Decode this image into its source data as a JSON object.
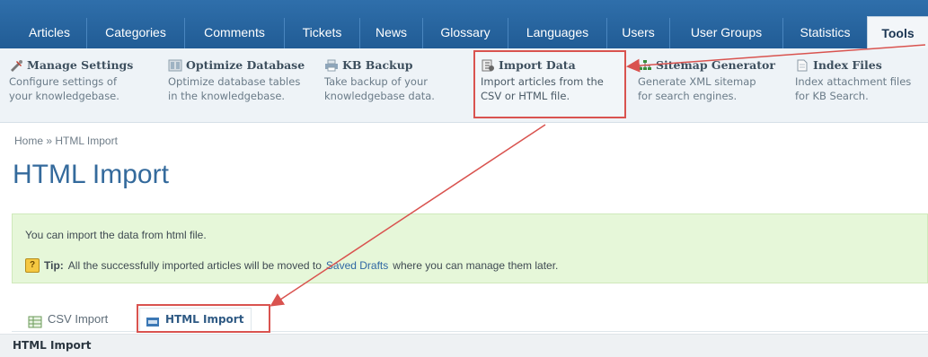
{
  "nav": {
    "tabs": [
      {
        "label": "Articles"
      },
      {
        "label": "Categories"
      },
      {
        "label": "Comments"
      },
      {
        "label": "Tickets"
      },
      {
        "label": "News"
      },
      {
        "label": "Glossary"
      },
      {
        "label": "Languages"
      },
      {
        "label": "Users"
      },
      {
        "label": "User Groups"
      },
      {
        "label": "Statistics"
      },
      {
        "label": "Tools"
      }
    ],
    "active": "Tools"
  },
  "tools": [
    {
      "title": "Manage Settings",
      "line1": "Configure settings of",
      "line2": "your knowledgebase.",
      "icon": "tools-icon"
    },
    {
      "title": "Optimize Database",
      "line1": "Optimize database tables",
      "line2": "in the knowledgebase.",
      "icon": "database-icon"
    },
    {
      "title": "KB Backup",
      "line1": "Take backup of your",
      "line2": "knowledgebase data.",
      "icon": "printer-icon"
    },
    {
      "title": "Import Data",
      "line1": "Import articles from the",
      "line2": "CSV or HTML file.",
      "icon": "import-icon"
    },
    {
      "title": "Sitemap Generator",
      "line1": "Generate XML sitemap",
      "line2": "for search engines.",
      "icon": "sitemap-icon"
    },
    {
      "title": "Index Files",
      "line1": "Index attachment files",
      "line2": "for KB Search.",
      "icon": "file-icon"
    }
  ],
  "breadcrumb": "Home » HTML Import",
  "page_title": "HTML Import",
  "notice": {
    "line1": "You can import the data from html file.",
    "tip_label": "Tip:",
    "tip_before": "All the successfully imported articles will be moved to",
    "tip_link": "Saved Drafts",
    "tip_after": "where you can manage them later."
  },
  "subtabs": [
    {
      "label": "CSV Import"
    },
    {
      "label": "HTML Import"
    }
  ],
  "section_title": "HTML Import",
  "colors": {
    "nav_bg": "#215c95",
    "title": "#346a9c",
    "highlight": "#d9534f",
    "notice_bg": "#e6f7d9"
  }
}
